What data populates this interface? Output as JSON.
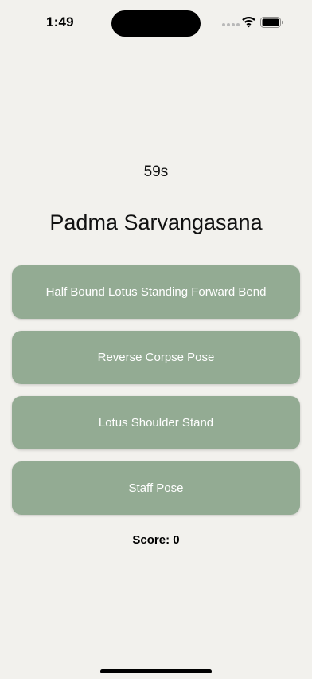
{
  "status_bar": {
    "time": "1:49",
    "icons": [
      "signal-dots-icon",
      "wifi-icon",
      "battery-icon"
    ]
  },
  "quiz": {
    "timer": "59s",
    "pose_name": "Padma Sarvangasana",
    "options": [
      "Half Bound Lotus Standing Forward Bend",
      "Reverse Corpse Pose",
      "Lotus Shoulder Stand",
      "Staff Pose"
    ],
    "score": "Score: 0"
  },
  "colors": {
    "background": "#f2f1ed",
    "button": "#93ab93",
    "button_text": "#ffffff"
  }
}
